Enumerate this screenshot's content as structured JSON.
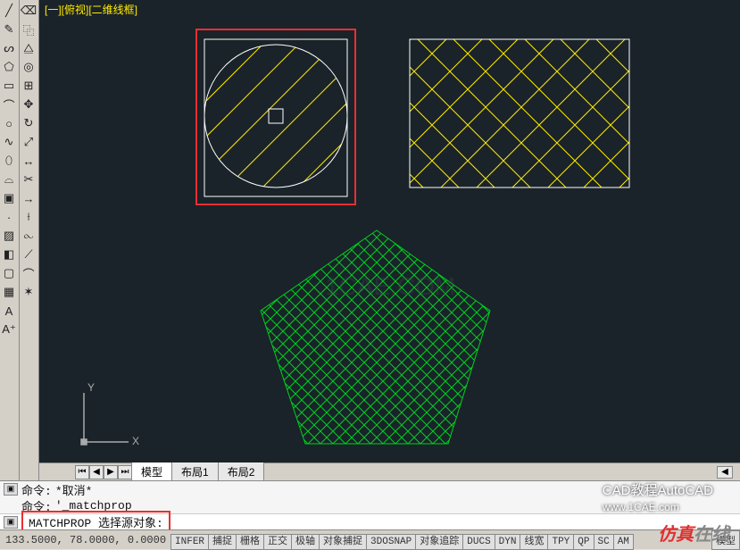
{
  "view_label": "[一][俯视][二维线框]",
  "tabs": {
    "model": "模型",
    "layout1": "布局1",
    "layout2": "布局2"
  },
  "cmd": {
    "line1_label": "命令:",
    "line1_text": "*取消*",
    "line2_label": "命令:",
    "line2_text": "'_matchprop",
    "line3": "MATCHPROP 选择源对象:"
  },
  "coords": "133.5000, 78.0000, 0.0000",
  "status_items": [
    "INFER",
    "捕捉",
    "栅格",
    "正交",
    "极轴",
    "对象捕捉",
    "3DOSNAP",
    "对象追踪",
    "DUCS",
    "DYN",
    "线宽",
    "TPY",
    "QP",
    "SC",
    "AM"
  ],
  "status_model": "模型",
  "watermark_top": "CAD教程AutoCAD",
  "watermark_link": "www.1CAE.com",
  "watermark_bottom_red": "仿真",
  "watermark_bottom_gray": "在线",
  "toolbar1": [
    {
      "name": "line-icon",
      "glyph": "╱"
    },
    {
      "name": "brush-icon",
      "glyph": "✎"
    },
    {
      "name": "pline-icon",
      "glyph": "ᔕ"
    },
    {
      "name": "polygon-icon",
      "glyph": "⬠"
    },
    {
      "name": "rectangle-icon",
      "glyph": "▭"
    },
    {
      "name": "arc-icon",
      "glyph": "⌒"
    },
    {
      "name": "circle-icon",
      "glyph": "○"
    },
    {
      "name": "spline-icon",
      "glyph": "∿"
    },
    {
      "name": "ellipse-icon",
      "glyph": "⬯"
    },
    {
      "name": "ellipse-arc-icon",
      "glyph": "⌓"
    },
    {
      "name": "block-icon",
      "glyph": "▣"
    },
    {
      "name": "point-icon",
      "glyph": "·"
    },
    {
      "name": "hatch-icon",
      "glyph": "▨"
    },
    {
      "name": "gradient-icon",
      "glyph": "◧"
    },
    {
      "name": "region-icon",
      "glyph": "▢"
    },
    {
      "name": "table-icon",
      "glyph": "▦"
    },
    {
      "name": "text-icon",
      "glyph": "A"
    },
    {
      "name": "addsel-icon",
      "glyph": "A⁺"
    }
  ],
  "toolbar2": [
    {
      "name": "eraser-icon",
      "glyph": "⌫"
    },
    {
      "name": "copy-icon",
      "glyph": "⿻"
    },
    {
      "name": "mirror-icon",
      "glyph": "⧋"
    },
    {
      "name": "offset-icon",
      "glyph": "◎"
    },
    {
      "name": "array-icon",
      "glyph": "⊞"
    },
    {
      "name": "move-icon",
      "glyph": "✥"
    },
    {
      "name": "rotate-icon",
      "glyph": "↻"
    },
    {
      "name": "scale-icon",
      "glyph": "⤢"
    },
    {
      "name": "stretch-icon",
      "glyph": "↔"
    },
    {
      "name": "trim-icon",
      "glyph": "✂"
    },
    {
      "name": "extend-icon",
      "glyph": "→"
    },
    {
      "name": "break-icon",
      "glyph": "⟊"
    },
    {
      "name": "join-icon",
      "glyph": "⧜"
    },
    {
      "name": "chamfer-icon",
      "glyph": "⟋"
    },
    {
      "name": "fillet-icon",
      "glyph": "⌒"
    },
    {
      "name": "explode-icon",
      "glyph": "✶"
    }
  ]
}
